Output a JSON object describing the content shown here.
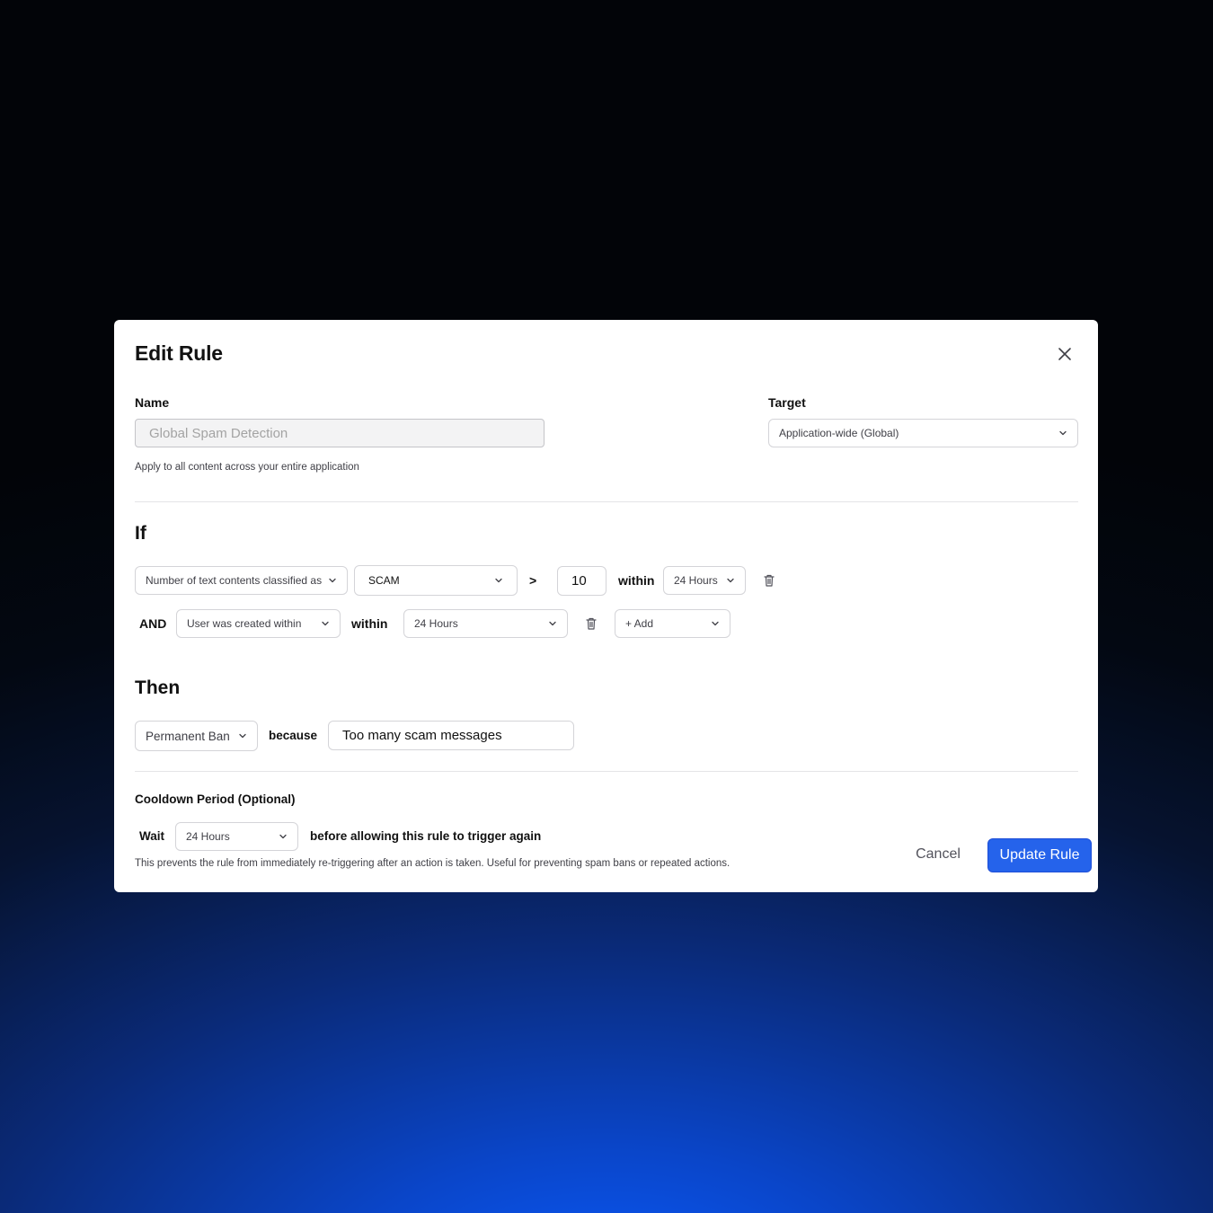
{
  "dialog": {
    "title": "Edit Rule",
    "close_icon": "close-icon"
  },
  "name": {
    "label": "Name",
    "placeholder": "Global Spam Detection",
    "hint": "Apply to all content across your entire application"
  },
  "target": {
    "label": "Target",
    "value": "Application-wide (Global)"
  },
  "if_section": {
    "heading": "If",
    "row1": {
      "metric": "Number of text contents classified as",
      "classification": "SCAM",
      "operator": ">",
      "threshold": "10",
      "within_label": "within",
      "window": "24 Hours"
    },
    "row2": {
      "conjunction": "AND",
      "condition": "User was created within",
      "within_label": "within",
      "window": "24 Hours",
      "add_label": "+ Add"
    }
  },
  "then_section": {
    "heading": "Then",
    "action": "Permanent Ban",
    "because_label": "because",
    "reason": "Too many scam messages"
  },
  "cooldown": {
    "label": "Cooldown Period (Optional)",
    "wait_label": "Wait",
    "period": "24 Hours",
    "suffix": "before allowing this rule to trigger again",
    "hint": "This prevents the rule from immediately re-triggering after an action is taken. Useful for preventing spam bans or repeated actions."
  },
  "actions": {
    "cancel": "Cancel",
    "update": "Update Rule"
  },
  "colors": {
    "accent": "#2563eb"
  }
}
